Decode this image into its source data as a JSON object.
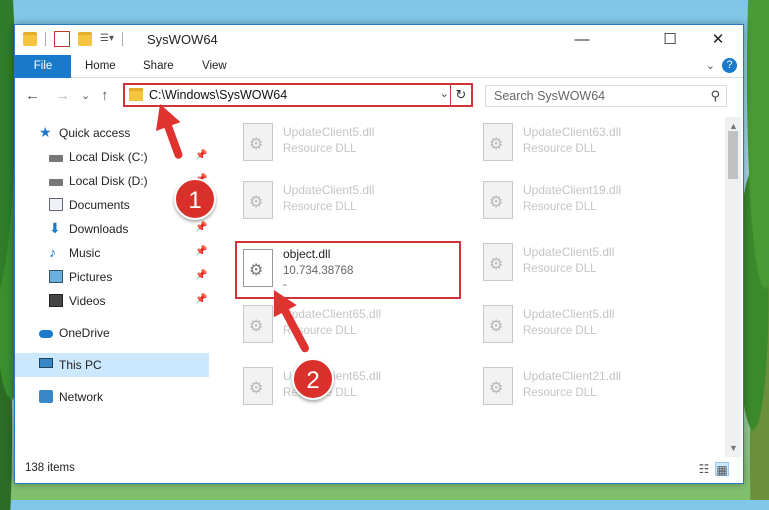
{
  "window": {
    "title": "SysWOW64"
  },
  "window_controls": {
    "minimize": "—",
    "maximize": "☐",
    "close": "✕"
  },
  "ribbon": {
    "tabs": [
      "File",
      "Home",
      "Share",
      "View"
    ],
    "expand": "⌄",
    "help": "?"
  },
  "nav": {
    "back": "←",
    "forward": "→",
    "recent": "⌄",
    "up": "↑"
  },
  "address": {
    "path": "C:\\Windows\\SysWOW64",
    "dropdown": "⌄",
    "refresh": "↻"
  },
  "search": {
    "placeholder": "Search SysWOW64",
    "icon": "search-icon"
  },
  "sidebar": {
    "items": [
      {
        "label": "Quick access",
        "icon": "star-icon",
        "pinned": false
      },
      {
        "label": "Local Disk (C:)",
        "icon": "drive-icon",
        "pinned": true
      },
      {
        "label": "Local Disk (D:)",
        "icon": "drive-icon",
        "pinned": true
      },
      {
        "label": "Documents",
        "icon": "documents-icon",
        "pinned": true
      },
      {
        "label": "Downloads",
        "icon": "downloads-icon",
        "pinned": true
      },
      {
        "label": "Music",
        "icon": "music-icon",
        "pinned": true
      },
      {
        "label": "Pictures",
        "icon": "pictures-icon",
        "pinned": true
      },
      {
        "label": "Videos",
        "icon": "videos-icon",
        "pinned": true
      },
      {
        "label": "OneDrive",
        "icon": "onedrive-icon",
        "pinned": false
      },
      {
        "label": "This PC",
        "icon": "this-pc-icon",
        "pinned": false,
        "selected": true
      },
      {
        "label": "Network",
        "icon": "network-icon",
        "pinned": false
      }
    ],
    "pin_glyph": "📌"
  },
  "files": [
    {
      "name": "UpdateClient5.dll",
      "desc": "Resource DLL"
    },
    {
      "name": "UpdateClient63.dll",
      "desc": "Resource DLL"
    },
    {
      "name": "UpdateClient5.dll",
      "desc": "Resource DLL"
    },
    {
      "name": "UpdateClient19.dll",
      "desc": "Resource DLL"
    },
    {
      "name": "object.dll",
      "desc": "10.734.38768",
      "extra": "-",
      "highlighted": true
    },
    {
      "name": "UpdateClient5.dll",
      "desc": "Resource DLL"
    },
    {
      "name": "UpdateClient65.dll",
      "desc": "Resource DLL"
    },
    {
      "name": "UpdateClient5.dll",
      "desc": "Resource DLL"
    },
    {
      "name": "UpdateClient65.dll",
      "desc": "Resource DLL"
    },
    {
      "name": "UpdateClient21.dll",
      "desc": "Resource DLL"
    }
  ],
  "status": {
    "item_count": "138 items"
  },
  "callouts": {
    "step1": "1",
    "step2": "2"
  },
  "colors": {
    "accent": "#1979ca",
    "highlight_red": "#d0343a",
    "selected_bg": "#cce8ff"
  }
}
